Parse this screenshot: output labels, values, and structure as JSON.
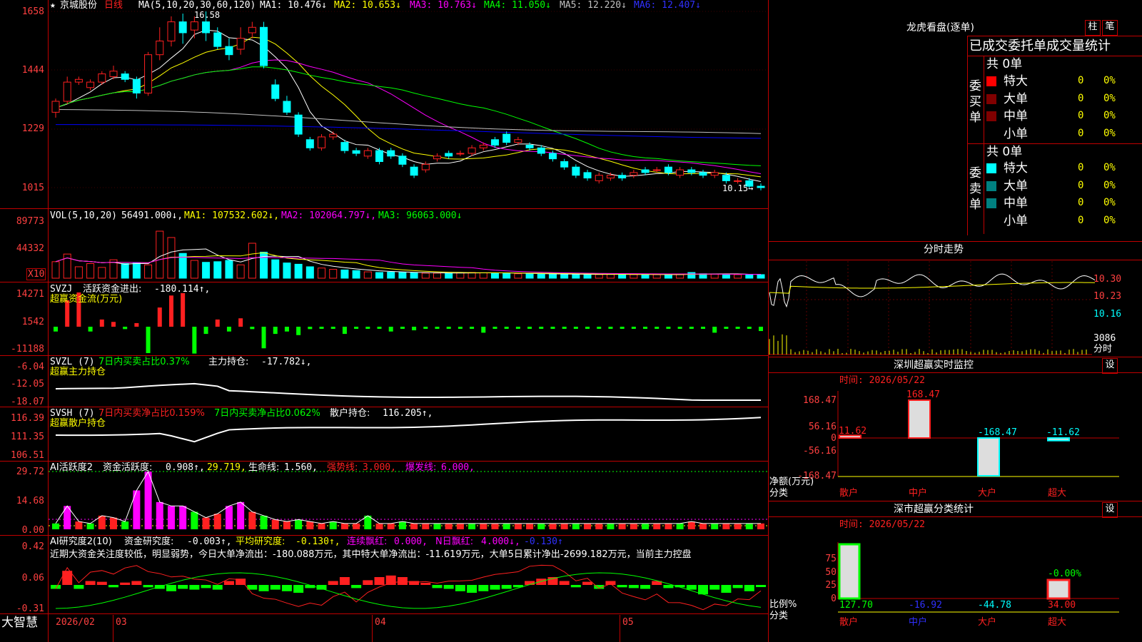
{
  "colors": {
    "up": "#ff2020",
    "down": "#00ffff",
    "ma1": "#ffffff",
    "ma2": "#ffff00",
    "ma3": "#ff00ff",
    "ma4": "#00ff00",
    "ma5": "#c0c0c0",
    "ma6": "#0000ff",
    "grid": "#c00000",
    "green": "#00ff00",
    "magenta": "#ff00ff",
    "yellow": "#ffff00"
  },
  "header": {
    "star": "★",
    "stock_name": "京城股份",
    "period": "日线",
    "ma_title": "MA(5,10,20,30,60,120)",
    "ma1": "MA1: 10.476↓",
    "ma2": "MA2: 10.653↓",
    "ma3": "MA3: 10.763↓",
    "ma4": "MA4: 11.050↓",
    "ma5": "MA5: 12.220↓",
    "ma6": "MA6: 12.407↓",
    "high_label": "16.58",
    "low_label": "10.15→"
  },
  "axes": {
    "price_ticks": [
      "1658",
      "1444",
      "1229",
      "1015"
    ],
    "vol_ticks": [
      "89773",
      "44332"
    ],
    "vol_unit": "X10",
    "svzj_ticks": [
      "14271",
      "1542",
      "-11188"
    ],
    "svzl_ticks": [
      "-6.04",
      "-12.05",
      "-18.07"
    ],
    "svsh_ticks": [
      "116.39",
      "111.35",
      "106.51"
    ],
    "ai1_ticks": [
      "29.72",
      "14.68",
      "0.00"
    ],
    "ai2_ticks": [
      "0.42",
      "0.06",
      "-0.31"
    ],
    "date_labels": [
      "2026/02",
      "03",
      "04",
      "05"
    ],
    "brand": "大智慧"
  },
  "panels": {
    "vol": {
      "title": "VOL(5,10,20)",
      "value": "56491.000↓,",
      "ma1": "MA1: 107532.602↓,",
      "ma2": "MA2: 102064.797↓,",
      "ma3": "MA3: 96063.000↓"
    },
    "svzj": {
      "title": "SVZJ",
      "label": "活跃资金进出:",
      "value": "-180.114↑,",
      "subtitle": "超赢资金流(万元)"
    },
    "svzl": {
      "title": "SVZL (7)",
      "l1": "7日内买卖占比0.37%",
      "l2": "主力持仓:",
      "value": "-17.782↓,",
      "subtitle": "超赢主力持仓"
    },
    "svsh": {
      "title": "SVSH (7)",
      "l1": "7日内买卖净占比0.159%",
      "l2": "7日内买卖净占比0.062%",
      "l3": "散户持仓:",
      "value": "116.205↑,",
      "subtitle": "超赢散户持仓"
    },
    "ai1": {
      "title": "AI活跃度2",
      "l1": "资金活跃度:",
      "v1": "0.908↑,",
      "v2": "29.719,",
      "l3": "生命线:",
      "v3": "1.560,",
      "l4": "强势线:",
      "v4": "3.000,",
      "l5": "爆发线:",
      "v5": "6.000,"
    },
    "ai2": {
      "title": "AI研究度2(10)",
      "l1": "资金研究度:",
      "v1": "-0.003↑,",
      "l2": "平均研究度:",
      "v2": "-0.130↑,",
      "l3": "连续飘红:",
      "v3": "0.000,",
      "l4": "N日飘红:",
      "v4": "4.000↓,",
      "v5": "-0.130↑",
      "commentary": "近期大资金关注度较低，明显弱势，今日大单净流出：-180.088万元，其中特大单净流出：-11.619万元，大单5日累计净出-2699.182万元，当前主力控盘"
    }
  },
  "right": {
    "dragon_title": "龙虎看盘(逐单)",
    "btn1": "柱",
    "btn2": "笔",
    "stats_title": "已成交委托单成交量统计",
    "buy_group": "委买单",
    "buy_total": "共 0单",
    "sell_group": "委卖单",
    "sell_total": "共 0单",
    "buy_rows": [
      {
        "label": "特大",
        "count": "0",
        "pct": "0%",
        "color": "#ff0000"
      },
      {
        "label": "大单",
        "count": "0",
        "pct": "0%",
        "color": "#800000"
      },
      {
        "label": "中单",
        "count": "0",
        "pct": "0%",
        "color": "#800000"
      },
      {
        "label": "小单",
        "count": "0",
        "pct": "0%",
        "color": ""
      }
    ],
    "sell_rows": [
      {
        "label": "特大",
        "count": "0",
        "pct": "0%",
        "color": "#00ffff"
      },
      {
        "label": "大单",
        "count": "0",
        "pct": "0%",
        "color": "#008080"
      },
      {
        "label": "中单",
        "count": "0",
        "pct": "0%",
        "color": "#008080"
      },
      {
        "label": "小单",
        "count": "0",
        "pct": "0%",
        "color": ""
      }
    ],
    "intraday_title": "分时走势",
    "intraday_ticks": [
      "10.30",
      "10.23",
      "10.16"
    ],
    "intraday_vol": "3086",
    "intraday_vol_unit": "分时",
    "monitor_title": "深圳超赢实时监控",
    "monitor_btn": "设",
    "monitor_time": "时间: 2026/05/22",
    "monitor_ticks": [
      "168.47",
      "56.16",
      "0",
      "-56.16",
      "-168.47"
    ],
    "monitor_ylabel": "净额(万元)",
    "monitor_xlabel": "分类",
    "monitor_bar_labels": [
      "11.62",
      "168.47",
      "-168.47",
      "-11.62"
    ],
    "categories": [
      "散户",
      "中户",
      "大户",
      "超大"
    ],
    "class_title": "深市超赢分类统计",
    "class_btn": "设",
    "class_time": "时间: 2026/05/22",
    "class_ticks": [
      "75",
      "50",
      "25",
      "0"
    ],
    "class_ylabel": "比例%",
    "class_xlabel": "分类",
    "class_top_label": "-0.00%",
    "class_values": [
      "127.70",
      "-16.92",
      "-44.78",
      "34.00"
    ]
  },
  "chart_data": {
    "type": "candlestick",
    "price_range": [
      1015,
      1658
    ],
    "candles": [
      [
        1290,
        1330,
        1270,
        1340
      ],
      [
        1330,
        1400,
        1320,
        1420
      ],
      [
        1400,
        1410,
        1390,
        1420
      ],
      [
        1380,
        1400,
        1370,
        1410
      ],
      [
        1400,
        1430,
        1390,
        1440
      ],
      [
        1420,
        1440,
        1410,
        1460
      ],
      [
        1430,
        1410,
        1400,
        1440
      ],
      [
        1410,
        1360,
        1340,
        1420
      ],
      [
        1360,
        1500,
        1350,
        1510
      ],
      [
        1500,
        1550,
        1480,
        1600
      ],
      [
        1550,
        1620,
        1530,
        1640
      ],
      [
        1620,
        1580,
        1540,
        1650
      ],
      [
        1590,
        1620,
        1560,
        1640
      ],
      [
        1620,
        1580,
        1550,
        1658
      ],
      [
        1580,
        1530,
        1520,
        1600
      ],
      [
        1530,
        1500,
        1480,
        1560
      ],
      [
        1520,
        1560,
        1500,
        1600
      ],
      [
        1580,
        1600,
        1560,
        1620
      ],
      [
        1600,
        1460,
        1450,
        1620
      ],
      [
        1390,
        1340,
        1330,
        1410
      ],
      [
        1330,
        1290,
        1280,
        1350
      ],
      [
        1280,
        1210,
        1200,
        1290
      ],
      [
        1190,
        1160,
        1150,
        1200
      ],
      [
        1160,
        1200,
        1150,
        1210
      ],
      [
        1200,
        1210,
        1190,
        1220
      ],
      [
        1180,
        1150,
        1140,
        1190
      ],
      [
        1150,
        1140,
        1130,
        1160
      ],
      [
        1130,
        1150,
        1120,
        1160
      ],
      [
        1150,
        1110,
        1100,
        1160
      ],
      [
        1150,
        1130,
        1120,
        1160
      ],
      [
        1130,
        1100,
        1090,
        1140
      ],
      [
        1090,
        1060,
        1050,
        1100
      ],
      [
        1080,
        1100,
        1070,
        1110
      ],
      [
        1120,
        1130,
        1110,
        1140
      ],
      [
        1140,
        1130,
        1120,
        1150
      ],
      [
        1140,
        1140,
        1130,
        1150
      ],
      [
        1140,
        1160,
        1130,
        1170
      ],
      [
        1160,
        1170,
        1150,
        1180
      ],
      [
        1190,
        1170,
        1160,
        1200
      ],
      [
        1210,
        1180,
        1170,
        1220
      ],
      [
        1180,
        1190,
        1170,
        1200
      ],
      [
        1170,
        1160,
        1150,
        1180
      ],
      [
        1160,
        1140,
        1130,
        1170
      ],
      [
        1140,
        1120,
        1110,
        1150
      ],
      [
        1110,
        1090,
        1080,
        1120
      ],
      [
        1090,
        1060,
        1050,
        1100
      ],
      [
        1070,
        1050,
        1040,
        1080
      ],
      [
        1040,
        1060,
        1030,
        1070
      ],
      [
        1050,
        1060,
        1040,
        1070
      ],
      [
        1060,
        1050,
        1040,
        1070
      ],
      [
        1060,
        1070,
        1050,
        1080
      ],
      [
        1080,
        1070,
        1060,
        1090
      ],
      [
        1080,
        1080,
        1070,
        1090
      ],
      [
        1090,
        1070,
        1060,
        1100
      ],
      [
        1060,
        1080,
        1050,
        1090
      ],
      [
        1080,
        1070,
        1060,
        1090
      ],
      [
        1070,
        1060,
        1050,
        1080
      ],
      [
        1060,
        1070,
        1050,
        1080
      ],
      [
        1060,
        1040,
        1030,
        1070
      ],
      [
        1040,
        1040,
        1030,
        1050
      ],
      [
        1040,
        1020,
        1010,
        1050
      ],
      [
        1020,
        1015,
        1005,
        1030
      ]
    ],
    "volume": [
      26000,
      38000,
      18000,
      23000,
      17000,
      29000,
      23000,
      24000,
      21000,
      74000,
      64000,
      39000,
      28000,
      25000,
      26000,
      28000,
      21000,
      55000,
      41000,
      29000,
      24000,
      22000,
      18000,
      16000,
      14000,
      13000,
      12000,
      10000,
      9000,
      9500,
      9000,
      8500,
      8000,
      8000,
      7500,
      9000,
      9000,
      8500,
      8000,
      7500,
      7000,
      7000,
      6500,
      6500,
      6000,
      6000,
      6200,
      5800,
      6000,
      6000,
      5800,
      5800,
      5600,
      5500,
      5700,
      9000,
      7000,
      6500,
      6000,
      5600,
      5500,
      5649
    ],
    "svzj": [
      -2000,
      11000,
      14271,
      -2000,
      3000,
      2000,
      -1000,
      1500,
      -11000,
      8000,
      13000,
      14000,
      -11188,
      -3000,
      3000,
      -2000,
      3500,
      -1000,
      -9000,
      -3000,
      -2000,
      -3500,
      -1000,
      -500,
      -500,
      -3000,
      -400,
      -400,
      -300,
      -2000,
      -600,
      -1500,
      -300,
      -300,
      -400,
      -500,
      -300,
      -2500,
      -500,
      -300,
      -300,
      -300,
      -300,
      -300,
      -300,
      -300,
      -300,
      -300,
      -300,
      -300,
      -300,
      -300,
      -300,
      -300,
      -300,
      -300,
      -300,
      -2500,
      -300,
      -300,
      -300,
      -1800
    ],
    "svzl_value": -17.782,
    "svsh_value": 116.205,
    "ai1_value": 0.908,
    "ai2_value": -0.003
  }
}
